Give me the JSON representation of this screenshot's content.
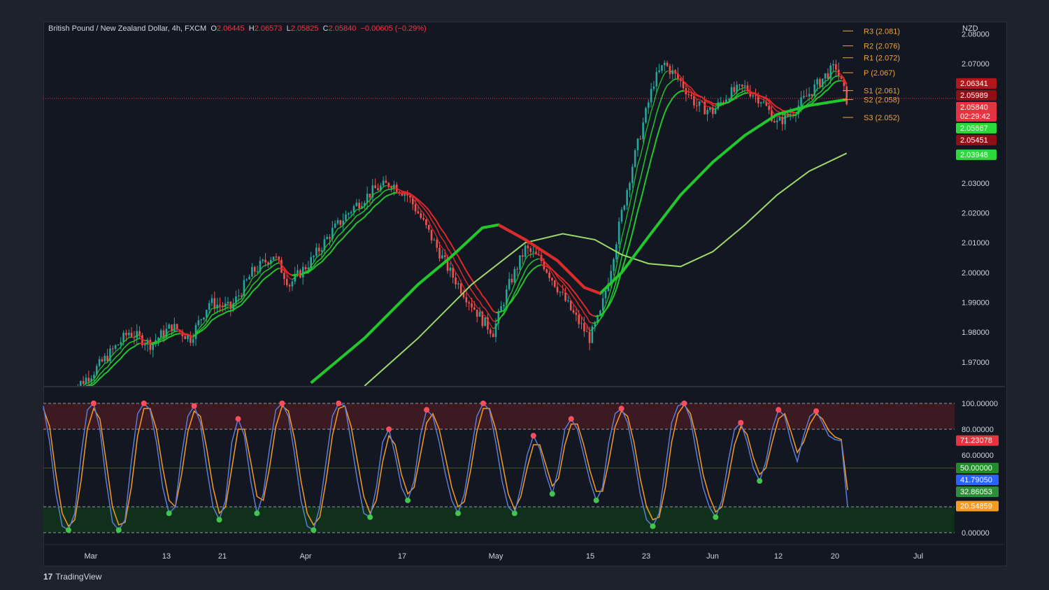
{
  "legend": {
    "symbol": "British Pound / New Zealand Dollar, 4h, FXCM",
    "o_label": "O",
    "o_value": "2.06445",
    "h_label": "H",
    "h_value": "2.06573",
    "l_label": "L",
    "l_value": "2.05825",
    "c_label": "C",
    "c_value": "2.05840",
    "change": "−0.00605 (−0.29%)"
  },
  "branding": {
    "logo_text": "TradingView"
  },
  "colors": {
    "up": "#26a69a",
    "down": "#ef5350",
    "ema_green": "#22c72e",
    "ema_red": "#e0282a",
    "slow_ma": "#9cd96a",
    "pivot": "#f0a33a",
    "stoch_k": "#5b7bd8",
    "stoch_d": "#f59a23",
    "overbought_zone": "#3c1a22",
    "oversold_zone": "#10301c"
  },
  "chart_data": [
    {
      "type": "candlestick",
      "title": "British Pound / New Zealand Dollar, 4h, FXCM",
      "currency": "NZD",
      "ylim": [
        1.962,
        2.082
      ],
      "y_ticks": [
        "2.08000",
        "2.07000",
        "2.03000",
        "2.02000",
        "2.01000",
        "2.00000",
        "1.99000",
        "1.98000",
        "1.97000"
      ],
      "x_ticks": [
        "Mar",
        "13",
        "21",
        "Apr",
        "17",
        "May",
        "15",
        "23",
        "Jun",
        "12",
        "20",
        "Jul"
      ],
      "close_path": [
        [
          0,
          1.96
        ],
        [
          8,
          1.966
        ],
        [
          14,
          1.972
        ],
        [
          22,
          1.98
        ],
        [
          30,
          1.976
        ],
        [
          38,
          1.982
        ],
        [
          45,
          1.978
        ],
        [
          52,
          1.99
        ],
        [
          60,
          1.988
        ],
        [
          68,
          2.0
        ],
        [
          76,
          2.006
        ],
        [
          82,
          1.996
        ],
        [
          90,
          2.004
        ],
        [
          98,
          2.014
        ],
        [
          106,
          2.022
        ],
        [
          114,
          2.028
        ],
        [
          120,
          2.03
        ],
        [
          126,
          2.026
        ],
        [
          130,
          2.02
        ],
        [
          136,
          2.01
        ],
        [
          142,
          2.0
        ],
        [
          148,
          1.992
        ],
        [
          154,
          1.984
        ],
        [
          158,
          1.98
        ],
        [
          164,
          1.996
        ],
        [
          170,
          2.008
        ],
        [
          176,
          2.004
        ],
        [
          182,
          1.995
        ],
        [
          188,
          1.986
        ],
        [
          194,
          1.978
        ],
        [
          198,
          1.986
        ],
        [
          202,
          2.002
        ],
        [
          206,
          2.02
        ],
        [
          210,
          2.036
        ],
        [
          214,
          2.05
        ],
        [
          218,
          2.064
        ],
        [
          222,
          2.07
        ],
        [
          228,
          2.064
        ],
        [
          234,
          2.056
        ],
        [
          240,
          2.054
        ],
        [
          246,
          2.06
        ],
        [
          252,
          2.062
        ],
        [
          258,
          2.058
        ],
        [
          264,
          2.05
        ],
        [
          270,
          2.054
        ],
        [
          276,
          2.06
        ],
        [
          282,
          2.066
        ],
        [
          286,
          2.069
        ],
        [
          290,
          2.058
        ]
      ],
      "last_index": 290,
      "pivots": [
        {
          "label": "R3 (2.081)",
          "value": 2.081
        },
        {
          "label": "R2 (2.076)",
          "value": 2.076
        },
        {
          "label": "R1 (2.072)",
          "value": 2.072
        },
        {
          "label": "P (2.067)",
          "value": 2.067
        },
        {
          "label": "S1 (2.061)",
          "value": 2.061
        },
        {
          "label": "S2 (2.058)",
          "value": 2.058
        },
        {
          "label": "S3 (2.052)",
          "value": 2.052
        }
      ],
      "price_badges": [
        {
          "text": "2.06341",
          "value": 2.06341,
          "color": "#b2161b"
        },
        {
          "text": "2.05989",
          "value": 2.05989,
          "color": "#8e1016"
        },
        {
          "text": "2.05840",
          "value": 2.0584,
          "color": "#e3343f",
          "extra": "02:29:42"
        },
        {
          "text": "2.05667",
          "value": 2.05667,
          "color": "#2bd93a"
        },
        {
          "text": "2.05451",
          "value": 2.05451,
          "color": "#8e1016"
        },
        {
          "text": "2.03948",
          "value": 2.03948,
          "color": "#2bd93a"
        }
      ],
      "slow_ma_path": [
        [
          110,
          1.962
        ],
        [
          130,
          1.978
        ],
        [
          150,
          1.996
        ],
        [
          170,
          2.01
        ],
        [
          184,
          2.013
        ],
        [
          196,
          2.011
        ],
        [
          206,
          2.006
        ],
        [
          216,
          2.003
        ],
        [
          228,
          2.002
        ],
        [
          240,
          2.007
        ],
        [
          252,
          2.016
        ],
        [
          264,
          2.026
        ],
        [
          276,
          2.034
        ],
        [
          290,
          2.04
        ]
      ],
      "main_ma_path": [
        [
          90,
          1.963
        ],
        [
          110,
          1.978
        ],
        [
          130,
          1.996
        ],
        [
          142,
          2.005
        ],
        [
          154,
          2.015
        ],
        [
          160,
          2.016
        ],
        [
          170,
          2.011
        ],
        [
          182,
          2.004
        ],
        [
          192,
          1.995
        ],
        [
          198,
          1.993
        ],
        [
          206,
          2.0
        ],
        [
          216,
          2.012
        ],
        [
          228,
          2.026
        ],
        [
          240,
          2.037
        ],
        [
          252,
          2.046
        ],
        [
          264,
          2.053
        ],
        [
          276,
          2.056
        ],
        [
          290,
          2.058
        ]
      ],
      "main_ma_red": [
        [
          160,
          2.016
        ],
        [
          198,
          1.993
        ]
      ]
    },
    {
      "type": "line",
      "indicator": "stochastic",
      "ylim": [
        0,
        100
      ],
      "y_ticks": [
        "100.00000",
        "80.00000",
        "60.00000",
        "0.00000"
      ],
      "levels": [
        100,
        80,
        50,
        20,
        0
      ],
      "k_values": [
        98,
        70,
        30,
        5,
        2,
        15,
        60,
        95,
        100,
        80,
        40,
        8,
        2,
        10,
        55,
        92,
        100,
        95,
        70,
        35,
        15,
        20,
        60,
        90,
        98,
        85,
        50,
        20,
        10,
        25,
        70,
        88,
        75,
        40,
        15,
        30,
        65,
        95,
        100,
        90,
        60,
        25,
        5,
        2,
        20,
        55,
        90,
        100,
        98,
        70,
        40,
        15,
        12,
        35,
        70,
        80,
        60,
        35,
        25,
        40,
        75,
        95,
        90,
        70,
        45,
        25,
        15,
        30,
        60,
        90,
        100,
        95,
        70,
        40,
        20,
        15,
        35,
        60,
        75,
        65,
        45,
        30,
        50,
        80,
        88,
        80,
        60,
        40,
        25,
        35,
        70,
        92,
        96,
        85,
        60,
        30,
        10,
        5,
        15,
        50,
        85,
        98,
        100,
        88,
        60,
        35,
        20,
        12,
        25,
        55,
        80,
        85,
        70,
        50,
        40,
        55,
        80,
        95,
        90,
        70,
        55,
        75,
        90,
        94,
        85,
        75,
        72,
        71,
        20
      ],
      "d_values": [
        96,
        82,
        45,
        15,
        5,
        10,
        40,
        80,
        96,
        88,
        55,
        20,
        6,
        8,
        35,
        75,
        96,
        96,
        80,
        50,
        25,
        20,
        45,
        78,
        94,
        90,
        65,
        35,
        15,
        20,
        50,
        80,
        80,
        55,
        28,
        25,
        50,
        82,
        98,
        94,
        72,
        40,
        15,
        6,
        12,
        40,
        75,
        96,
        98,
        82,
        55,
        28,
        15,
        25,
        55,
        75,
        68,
        45,
        30,
        35,
        60,
        85,
        92,
        80,
        58,
        35,
        20,
        24,
        48,
        78,
        96,
        96,
        80,
        55,
        30,
        18,
        28,
        50,
        68,
        68,
        52,
        36,
        42,
        68,
        84,
        84,
        68,
        48,
        32,
        32,
        55,
        82,
        94,
        90,
        70,
        42,
        20,
        10,
        12,
        35,
        70,
        92,
        99,
        92,
        72,
        45,
        28,
        16,
        20,
        42,
        68,
        82,
        76,
        58,
        45,
        50,
        70,
        88,
        92,
        78,
        62,
        70,
        84,
        92,
        88,
        79,
        74,
        72,
        33
      ],
      "value_badges": [
        {
          "text": "71.23078",
          "value": 71.23078,
          "color": "#e3343f"
        },
        {
          "text": "50.00000",
          "value": 50,
          "color": "#1f8d2a"
        },
        {
          "text": "41.79050",
          "value": 41.7905,
          "color": "#2962ff"
        },
        {
          "text": "32.86053",
          "value": 32.86053,
          "color": "#2d8f3c"
        },
        {
          "text": "20.54859",
          "value": 20.54859,
          "color": "#f59a23"
        }
      ]
    }
  ]
}
